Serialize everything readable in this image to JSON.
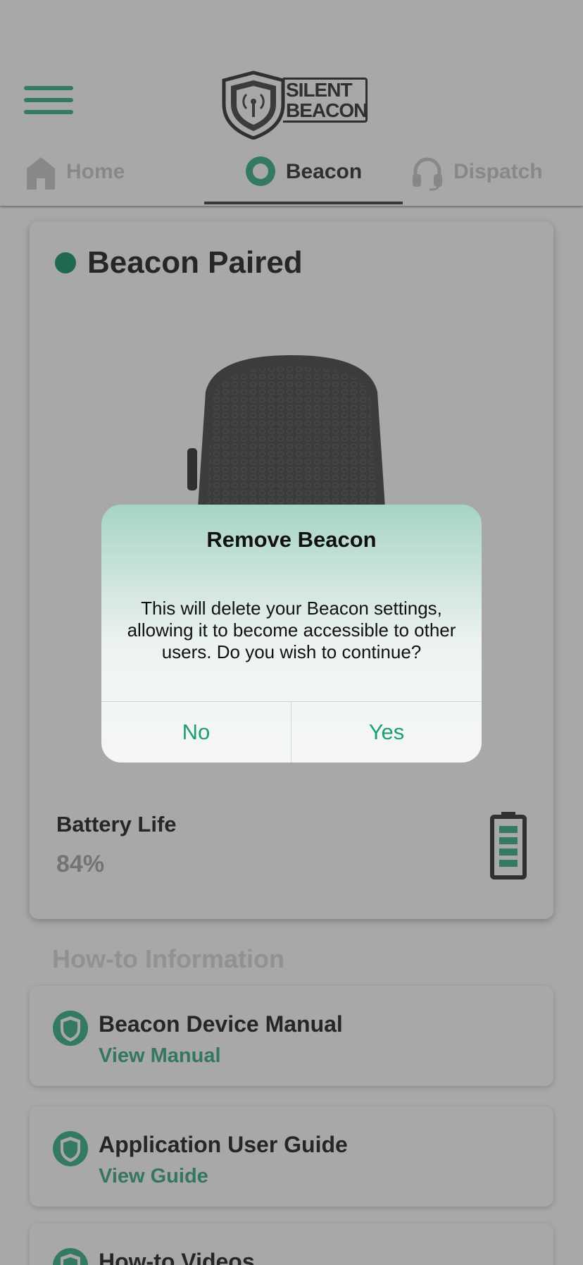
{
  "header": {
    "logo_line1": "SILENT",
    "logo_line2": "BEACON",
    "tabs": [
      {
        "label": "Home",
        "icon": "home-icon"
      },
      {
        "label": "Beacon",
        "icon": "beacon-icon"
      },
      {
        "label": "Dispatch",
        "icon": "headset-icon"
      }
    ]
  },
  "card": {
    "status": "Beacon Paired",
    "battery_title": "Battery Life",
    "battery_value": "84%",
    "battery_level": 0.84
  },
  "howto": {
    "title": "How-to Information",
    "items": [
      {
        "title": "Beacon Device Manual",
        "link": "View Manual"
      },
      {
        "title": "Application User Guide",
        "link": "View Guide"
      },
      {
        "title": "How-to Videos",
        "link": ""
      }
    ]
  },
  "dialog": {
    "title": "Remove Beacon",
    "message": "This will delete your Beacon settings, allowing it to become accessible to other users. Do you wish to continue?",
    "no_label": "No",
    "yes_label": "Yes"
  },
  "colors": {
    "accent": "#50b898",
    "link": "#4fb58e",
    "dialog_button": "#1e9f72",
    "status_dot": "#2fa07a"
  }
}
